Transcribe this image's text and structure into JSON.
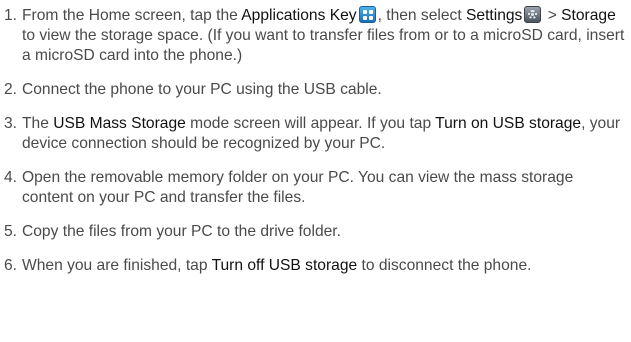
{
  "steps": [
    {
      "number": "1.",
      "parts": [
        {
          "type": "text",
          "value": "From the Home screen, tap the "
        },
        {
          "type": "bold",
          "value": "Applications Key"
        },
        {
          "type": "icon",
          "icon": "applications-key-icon"
        },
        {
          "type": "text",
          "value": ", then select "
        },
        {
          "type": "bold",
          "value": "Settings"
        },
        {
          "type": "icon",
          "icon": "settings-icon"
        },
        {
          "type": "text",
          "value": " > "
        },
        {
          "type": "bold",
          "value": "Storage"
        },
        {
          "type": "text",
          "value": " to view the storage space. (If you want to transfer files from or to a microSD card, insert a microSD card into the phone.)"
        }
      ]
    },
    {
      "number": "2.",
      "parts": [
        {
          "type": "text",
          "value": "Connect the phone to your PC using the USB cable."
        }
      ]
    },
    {
      "number": "3.",
      "parts": [
        {
          "type": "text",
          "value": "The "
        },
        {
          "type": "bold",
          "value": "USB Mass Storage"
        },
        {
          "type": "text",
          "value": " mode screen will appear. If you tap "
        },
        {
          "type": "bold",
          "value": "Turn on USB storage"
        },
        {
          "type": "text",
          "value": ", your device connection should be recognized by your PC."
        }
      ]
    },
    {
      "number": "4.",
      "parts": [
        {
          "type": "text",
          "value": "Open the removable memory folder on your PC. You can view the mass storage content on your PC and transfer the files."
        }
      ]
    },
    {
      "number": "5.",
      "parts": [
        {
          "type": "text",
          "value": "Copy the files from your PC to the drive folder."
        }
      ]
    },
    {
      "number": "6.",
      "parts": [
        {
          "type": "text",
          "value": "When you are finished, tap "
        },
        {
          "type": "bold",
          "value": "Turn off USB storage"
        },
        {
          "type": "text",
          "value": " to disconnect the phone."
        }
      ]
    }
  ]
}
